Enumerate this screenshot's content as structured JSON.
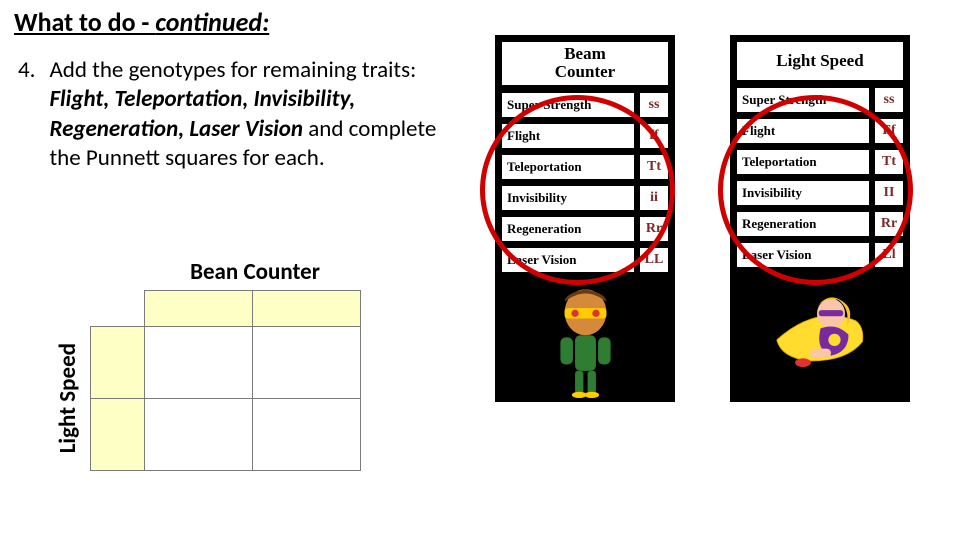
{
  "title_main": "What to do - ",
  "title_cont": "continued:",
  "step_number": "4.",
  "instruction_lead": "Add the genotypes for remaining traits:  ",
  "instruction_bold": "Flight, Teleportation, Invisibility, Regeneration, Laser Vision",
  "instruction_tail": " and complete the Punnett squares for each.",
  "punnett": {
    "top_label": "Bean Counter",
    "side_label": "Light Speed"
  },
  "cards": [
    {
      "title_line1": "Beam",
      "title_line2": "Counter",
      "traits": [
        {
          "name": "Super Strength",
          "geno": "ss"
        },
        {
          "name": "Flight",
          "geno": "ff"
        },
        {
          "name": "Teleportation",
          "geno": "Tt"
        },
        {
          "name": "Invisibility",
          "geno": "ii"
        },
        {
          "name": "Regeneration",
          "geno": "Rr"
        },
        {
          "name": "Laser Vision",
          "geno": "LL"
        }
      ]
    },
    {
      "title_line1": "Light Speed",
      "title_line2": "",
      "traits": [
        {
          "name": "Super Strength",
          "geno": "ss"
        },
        {
          "name": "Flight",
          "geno": "Ff"
        },
        {
          "name": "Teleportation",
          "geno": "Tt"
        },
        {
          "name": "Invisibility",
          "geno": "II"
        },
        {
          "name": "Regeneration",
          "geno": "Rr"
        },
        {
          "name": "Laser Vision",
          "geno": "Ll"
        }
      ]
    }
  ]
}
